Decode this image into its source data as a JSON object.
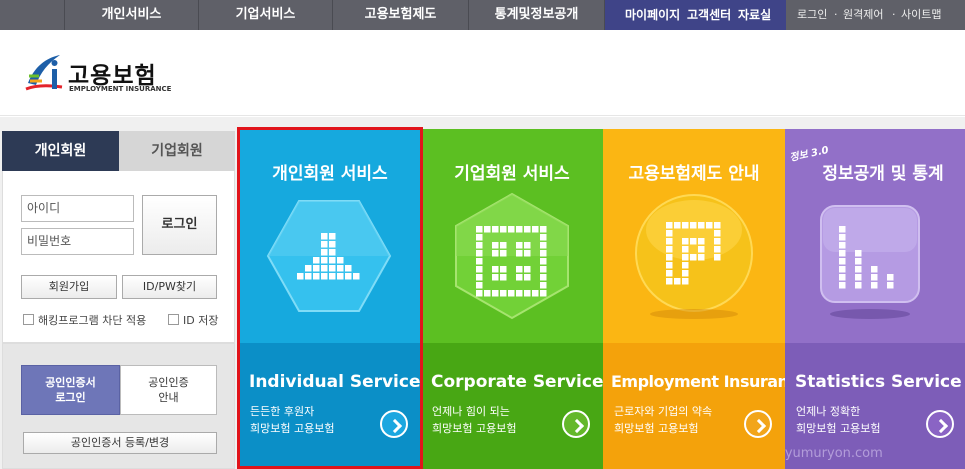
{
  "topnav": {
    "menus": [
      "개인서비스",
      "기업서비스",
      "고용보험제도",
      "통계및정보공개"
    ],
    "util": [
      "마이페이지",
      "고객센터",
      "자료실"
    ],
    "right": [
      "로그인",
      "원격제어",
      "사이트맵"
    ],
    "sep": "·"
  },
  "header": {
    "logo_ko": "고용보험",
    "logo_en": "EMPLOYMENT INSURANCE"
  },
  "login": {
    "tab_person": "개인회원",
    "tab_corp": "기업회원",
    "id_placeholder": "아이디",
    "pw_placeholder": "비밀번호",
    "login_button": "로그인",
    "join_button": "회원가입",
    "find_button": "ID/PW찾기",
    "hack_block_label": "해킹프로그램 차단 적용",
    "save_id_label": "ID 저장"
  },
  "cert": {
    "login_line1": "공인인증서",
    "login_line2": "로그인",
    "guide_line1": "공인인증",
    "guide_line2": "안내",
    "register": "공인인증서 등록/변경"
  },
  "services": [
    {
      "title": "개인회원 서비스",
      "en": "Individual Service",
      "desc1": "든든한 후원자",
      "desc2": "희망보험 고용보험",
      "color_top": "#16a9de",
      "color_bottom": "#0b8fc7",
      "go_color": "#1ca7e0"
    },
    {
      "title": "기업회원 서비스",
      "en": "Corporate Service",
      "desc1": "언제나 힘이 되는",
      "desc2": "희망보험 고용보험",
      "color_top": "#5cbf22",
      "color_bottom": "#48a714",
      "go_color": "#64b82a"
    },
    {
      "title": "고용보험제도 안내",
      "en": "Employment Insurance",
      "desc1": "근로자와 기업의 약속",
      "desc2": "희망보험 고용보험",
      "color_top": "#fbb613",
      "color_bottom": "#f4a20b",
      "go_color": "#f2a51a"
    },
    {
      "title": "정보공개 및 통계",
      "badge": "정보 3.0",
      "en": "Statistics Service",
      "desc1": "언제나 정확한",
      "desc2": "희망보험 고용보험",
      "color_top": "#9270c8",
      "color_bottom": "#7d5db8",
      "go_color": "#8a64c4"
    }
  ],
  "watermark": "http://yumuryon.com"
}
